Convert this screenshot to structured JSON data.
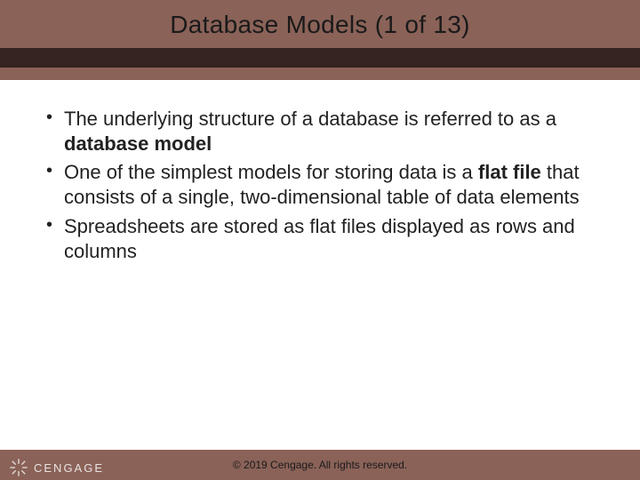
{
  "title": "Database Models (1 of 13)",
  "bullets": [
    {
      "pre": "The underlying structure of a database is referred to as a ",
      "bold": "database model",
      "post": ""
    },
    {
      "pre": "One of the simplest models for storing data is a ",
      "bold": "flat file",
      "post": " that consists of a single, two-dimensional table of data elements"
    },
    {
      "pre": "Spreadsheets are stored as flat files displayed as rows and columns",
      "bold": "",
      "post": ""
    }
  ],
  "footer": {
    "copyright": "© 2019 Cengage. All rights reserved.",
    "brand": "CENGAGE"
  }
}
